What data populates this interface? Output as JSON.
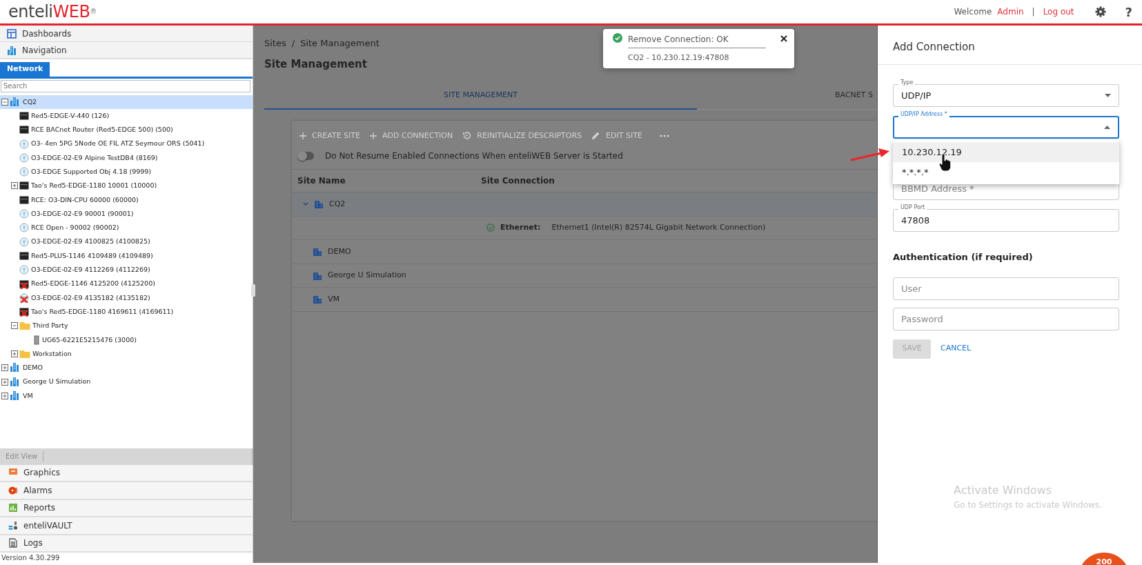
{
  "header": {
    "logo_text": "enteli",
    "logo_accent": "WEB",
    "logo_mark": "®",
    "welcome": "Welcome",
    "user": "Admin",
    "separator": "|",
    "logout": "Log out",
    "help": "?"
  },
  "sidebar": {
    "top_items": [
      {
        "label": "Dashboards",
        "kind": "dashboards"
      },
      {
        "label": "Navigation",
        "kind": "navigation"
      }
    ],
    "tabs": [
      {
        "label": "Network",
        "selected": true
      }
    ],
    "search": {
      "placeholder": "Search"
    },
    "tree": [
      {
        "label": "CQ2",
        "kind": "site",
        "expanded": true,
        "selected": true,
        "children": [
          {
            "label": "Red5-EDGE-V-440 (126)",
            "kind": "controller",
            "offline": false,
            "selected": false
          },
          {
            "label": "RCE BACnet Router (Red5-EDGE 500) (500)",
            "kind": "controller",
            "offline": false,
            "selected": false
          },
          {
            "label": "O3- 4en 5PG 5Node OE FIL ATZ Seymour ORS (5041)",
            "kind": "sensor",
            "offline": false,
            "selected": false
          },
          {
            "label": "O3-EDGE-02-E9 Alpine TestDB4 (8169)",
            "kind": "sensor",
            "offline": false,
            "selected": false
          },
          {
            "label": "O3-EDGE Supported Obj 4.18 (9999)",
            "kind": "sensor",
            "offline": false,
            "selected": false
          },
          {
            "label": "Tao's Red5-EDGE-1180 10001 (10000)",
            "kind": "controller",
            "offline": false,
            "expanded": false,
            "selected": false
          },
          {
            "label": "RCE: O3-DIN-CPU 60000 (60000)",
            "kind": "controller",
            "offline": false,
            "selected": false
          },
          {
            "label": "O3-EDGE-02-E9 90001 (90001)",
            "kind": "sensor",
            "offline": false,
            "selected": false
          },
          {
            "label": "RCE Open - 90002 (90002)",
            "kind": "sensor",
            "offline": false,
            "selected": false
          },
          {
            "label": "O3-EDGE-02-E9 4100825 (4100825)",
            "kind": "sensor",
            "offline": false,
            "selected": false
          },
          {
            "label": "Red5-PLUS-1146 4109489 (4109489)",
            "kind": "controller",
            "offline": false,
            "selected": false
          },
          {
            "label": "O3-EDGE-02-E9 4112269 (4112269)",
            "kind": "sensor",
            "offline": false,
            "selected": false
          },
          {
            "label": "Red5-EDGE-1146 4125200 (4125200)",
            "kind": "controller",
            "offline": true,
            "selected": false
          },
          {
            "label": "O3-EDGE-02-E9 4135182 (4135182)",
            "kind": "sensor",
            "offline": true,
            "selected": false
          },
          {
            "label": "Tao's Red5-EDGE-1180 4169611 (4169611)",
            "kind": "controller",
            "offline": true,
            "selected": false
          },
          {
            "label": "Third Party",
            "kind": "folder",
            "expanded": true,
            "selected": false,
            "children": [
              {
                "label": "UG65-6221E5215476 (3000)",
                "kind": "device",
                "selected": false
              }
            ]
          },
          {
            "label": "Workstation",
            "kind": "folder",
            "expanded": false,
            "selected": false
          }
        ]
      },
      {
        "label": "DEMO",
        "kind": "site",
        "expanded": false,
        "selected": false
      },
      {
        "label": "George U Simulation",
        "kind": "site",
        "expanded": false,
        "selected": false
      },
      {
        "label": "VM",
        "kind": "site",
        "expanded": false,
        "selected": false
      }
    ],
    "edit_view": {
      "label": "Edit View",
      "disabled": true
    },
    "bottom_items": [
      {
        "label": "Graphics",
        "kind": "graphics"
      },
      {
        "label": "Alarms",
        "kind": "alarms"
      },
      {
        "label": "Reports",
        "kind": "reports"
      },
      {
        "label": "enteliVAULT",
        "kind": "vault"
      },
      {
        "label": "Logs",
        "kind": "logs"
      }
    ],
    "version": "Version 4.30.299"
  },
  "main": {
    "breadcrumb": [
      "Sites",
      "Site Management"
    ],
    "breadcrumb_separator": "/",
    "title": "Site Management",
    "tabs": [
      {
        "label": "SITE MANAGEMENT",
        "selected": true
      },
      {
        "label": "BACNET S",
        "selected": false
      }
    ],
    "toolbar": [
      {
        "label": "CREATE SITE",
        "kind": "plus",
        "disabled": true
      },
      {
        "label": "ADD CONNECTION",
        "kind": "plus",
        "disabled": true
      },
      {
        "label": "REINITIALIZE DESCRIPTORS",
        "kind": "refresh",
        "disabled": true
      },
      {
        "label": "EDIT SITE",
        "kind": "edit",
        "disabled": true
      },
      {
        "kind": "more",
        "disabled": true
      }
    ],
    "toggle": {
      "label": "Do Not Resume Enabled Connections When enteliWEB Server is Started",
      "on": false
    },
    "table": {
      "columns": [
        "Site Name",
        "Site Connection"
      ],
      "rows": [
        {
          "kind": "site",
          "name": "CQ2",
          "expanded": true
        },
        {
          "kind": "connection",
          "ok": true,
          "type": "Ethernet:",
          "connection": "Ethernet1 (Intel(R) 82574L Gigabit Network Connection)"
        },
        {
          "kind": "site",
          "name": "DEMO"
        },
        {
          "kind": "site",
          "name": "George U Simulation"
        },
        {
          "kind": "site",
          "name": "VM"
        }
      ]
    }
  },
  "toast": {
    "success": true,
    "title": "Remove Connection: OK",
    "message": "CQ2 - 10.230.12.19:47808"
  },
  "panel": {
    "title": "Add Connection",
    "fields": [
      {
        "kind": "select",
        "label": "Type",
        "value": "UDP/IP",
        "focused": false,
        "expanded": false
      },
      {
        "kind": "select",
        "label": "UDP/IP Address *",
        "focused": true,
        "expanded": true,
        "options": [
          {
            "label": "10.230.12.19",
            "selected": true
          },
          {
            "label": "*.*.*.*",
            "selected": false
          }
        ]
      },
      {
        "kind": "text",
        "placeholder": "BBMD Address *"
      },
      {
        "kind": "text",
        "label": "UDP Port",
        "value": "47808"
      }
    ],
    "auth_heading": "Authentication (if required)",
    "auth_fields": [
      {
        "placeholder": "User"
      },
      {
        "placeholder": "Password"
      }
    ],
    "buttons": [
      {
        "label": "SAVE",
        "kind": "contained",
        "disabled": true
      },
      {
        "label": "CANCEL",
        "kind": "text",
        "disabled": false
      }
    ]
  },
  "os_notice": {
    "title": "Activate Windows",
    "message": "Go to Settings to activate Windows."
  },
  "badge": {
    "text": "200"
  }
}
